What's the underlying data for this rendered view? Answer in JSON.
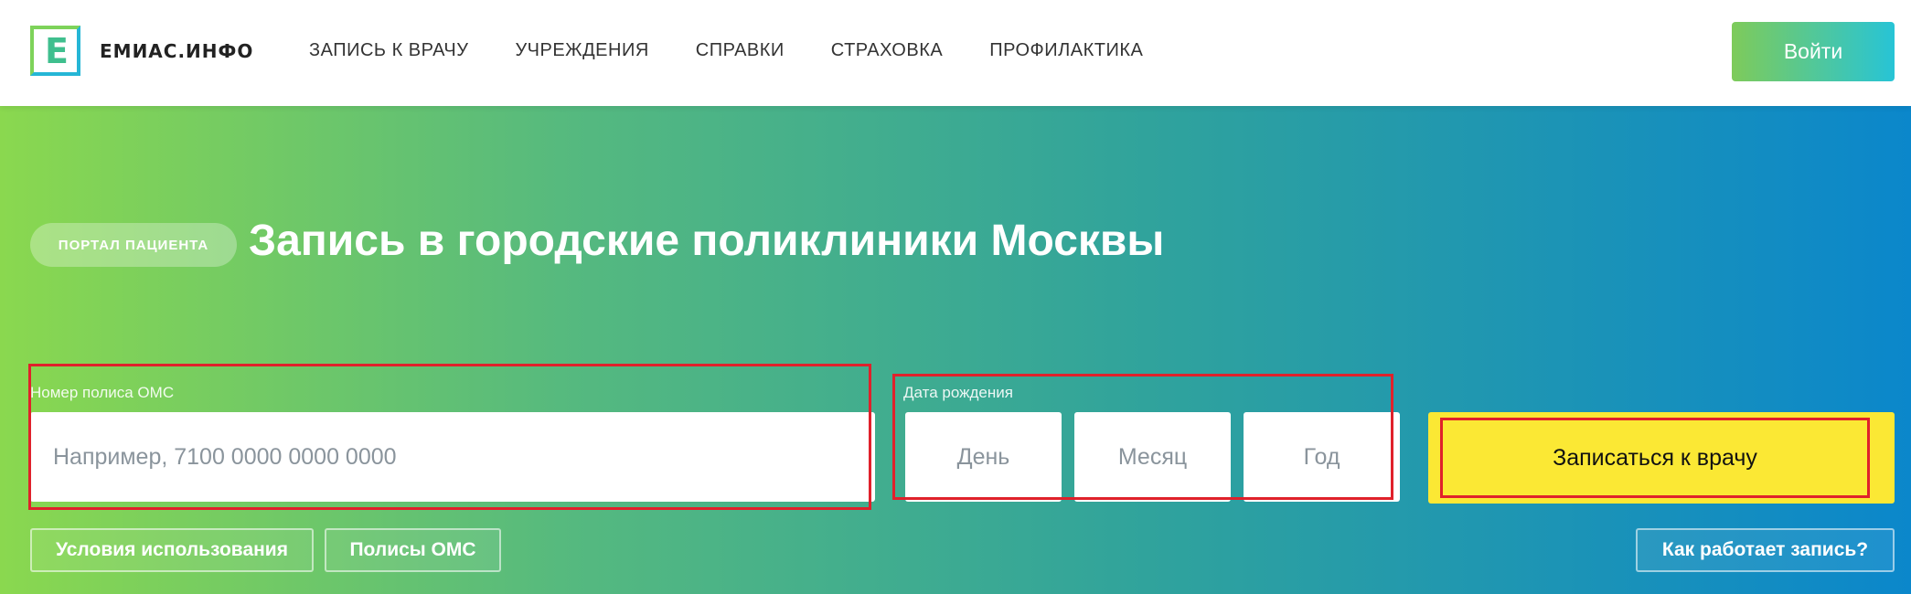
{
  "header": {
    "logo_letter": "E",
    "logo_text": "ЕМИАС.ИНФО",
    "nav": [
      {
        "label": "ЗАПИСЬ К ВРАЧУ"
      },
      {
        "label": "УЧРЕЖДЕНИЯ"
      },
      {
        "label": "СПРАВКИ"
      },
      {
        "label": "СТРАХОВКА"
      },
      {
        "label": "ПРОФИЛАКТИКА"
      }
    ],
    "login_label": "Войти"
  },
  "hero": {
    "badge": "ПОРТАЛ ПАЦИЕНТА",
    "title": "Запись в городские поликлиники Москвы"
  },
  "form": {
    "policy_label": "Номер полиса ОМС",
    "policy_placeholder": "Например, 7100 0000 0000 0000",
    "policy_value": "",
    "dob_label": "Дата рождения",
    "day_placeholder": "День",
    "month_placeholder": "Месяц",
    "year_placeholder": "Год",
    "submit_label": "Записаться к врачу"
  },
  "links": {
    "terms": "Условия использования",
    "policies": "Полисы ОМС",
    "how": "Как работает запись?"
  },
  "colors": {
    "accent_yellow": "#fbe834",
    "highlight_red": "#e0212b",
    "gradient_start": "#8ad84f",
    "gradient_end": "#0b87cb"
  }
}
